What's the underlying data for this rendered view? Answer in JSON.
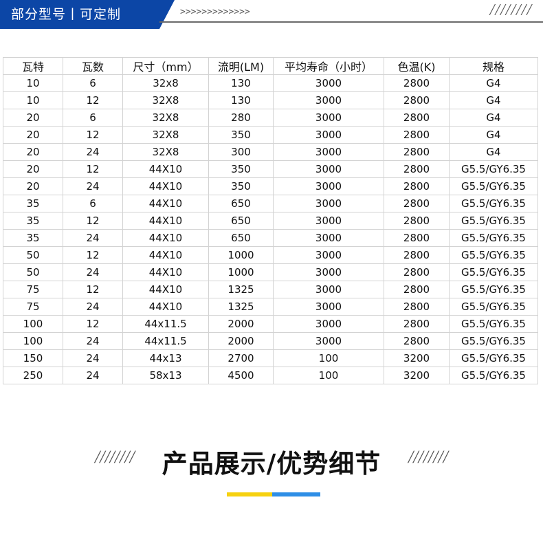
{
  "header": {
    "title": "部分型号丨可定制",
    "arrows": ">>>>>>>>>>>>>",
    "slashes": "////////"
  },
  "colors": {
    "banner_blue": "#0c46a6",
    "accent_yellow": "#f6d10f",
    "accent_blue": "#2e8ee6"
  },
  "table": {
    "columns": [
      "瓦特",
      "瓦数",
      "尺寸（mm）",
      "流明(LM)",
      "平均寿命（小时）",
      "色温(K)",
      "规格"
    ],
    "rows": [
      [
        "10",
        "6",
        "32x8",
        "130",
        "3000",
        "2800",
        "G4"
      ],
      [
        "10",
        "12",
        "32X8",
        "130",
        "3000",
        "2800",
        "G4"
      ],
      [
        "20",
        "6",
        "32X8",
        "280",
        "3000",
        "2800",
        "G4"
      ],
      [
        "20",
        "12",
        "32X8",
        "350",
        "3000",
        "2800",
        "G4"
      ],
      [
        "20",
        "24",
        "32X8",
        "300",
        "3000",
        "2800",
        "G4"
      ],
      [
        "20",
        "12",
        "44X10",
        "350",
        "3000",
        "2800",
        "G5.5/GY6.35"
      ],
      [
        "20",
        "24",
        "44X10",
        "350",
        "3000",
        "2800",
        "G5.5/GY6.35"
      ],
      [
        "35",
        "6",
        "44X10",
        "650",
        "3000",
        "2800",
        "G5.5/GY6.35"
      ],
      [
        "35",
        "12",
        "44X10",
        "650",
        "3000",
        "2800",
        "G5.5/GY6.35"
      ],
      [
        "35",
        "24",
        "44X10",
        "650",
        "3000",
        "2800",
        "G5.5/GY6.35"
      ],
      [
        "50",
        "12",
        "44X10",
        "1000",
        "3000",
        "2800",
        "G5.5/GY6.35"
      ],
      [
        "50",
        "24",
        "44X10",
        "1000",
        "3000",
        "2800",
        "G5.5/GY6.35"
      ],
      [
        "75",
        "12",
        "44X10",
        "1325",
        "3000",
        "2800",
        "G5.5/GY6.35"
      ],
      [
        "75",
        "24",
        "44X10",
        "1325",
        "3000",
        "2800",
        "G5.5/GY6.35"
      ],
      [
        "100",
        "12",
        "44x11.5",
        "2000",
        "3000",
        "2800",
        "G5.5/GY6.35"
      ],
      [
        "100",
        "24",
        "44x11.5",
        "2000",
        "3000",
        "2800",
        "G5.5/GY6.35"
      ],
      [
        "150",
        "24",
        "44x13",
        "2700",
        "100",
        "3200",
        "G5.5/GY6.35"
      ],
      [
        "250",
        "24",
        "58x13",
        "4500",
        "100",
        "3200",
        "G5.5/GY6.35"
      ]
    ]
  },
  "section": {
    "title": "产品展示/优势细节",
    "slashes_left": "////////",
    "slashes_right": "////////"
  }
}
